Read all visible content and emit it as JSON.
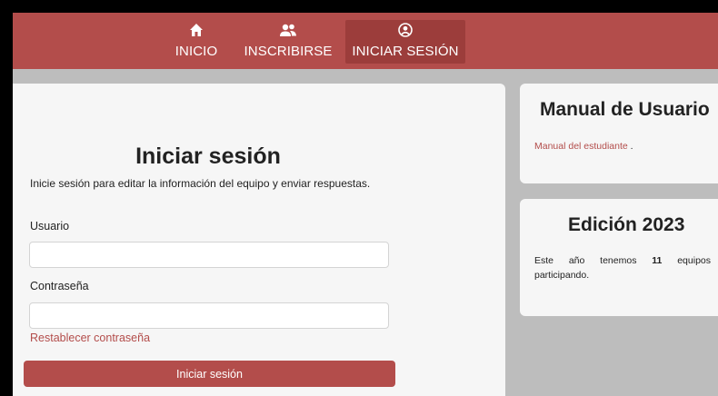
{
  "navbar": {
    "items": [
      {
        "label": "INICIO",
        "icon": "home-icon",
        "active": false
      },
      {
        "label": "INSCRIBIRSE",
        "icon": "users-icon",
        "active": false
      },
      {
        "label": "INICIAR SESIÓN",
        "icon": "user-circle-icon",
        "active": true
      }
    ]
  },
  "login": {
    "title": "Iniciar sesión",
    "subtitle": "Inicie sesión para editar la información del equipo y enviar respuestas.",
    "username_label": "Usuario",
    "username_value": "",
    "password_label": "Contraseña",
    "password_value": "",
    "reset_link": "Restablecer contraseña",
    "submit_label": "Iniciar sesión"
  },
  "manual": {
    "title": "Manual de Usuario",
    "link": "Manual del estudiante",
    "link_suffix": " ."
  },
  "edicion": {
    "title": "Edición 2023",
    "text_before": "Este año tenemos ",
    "team_count": "11",
    "text_after": " equipos participando."
  },
  "colors": {
    "accent": "#b34d4b",
    "accent_active": "#9c3d3b",
    "background": "#bdbdbd",
    "card": "#f6f6f6"
  }
}
